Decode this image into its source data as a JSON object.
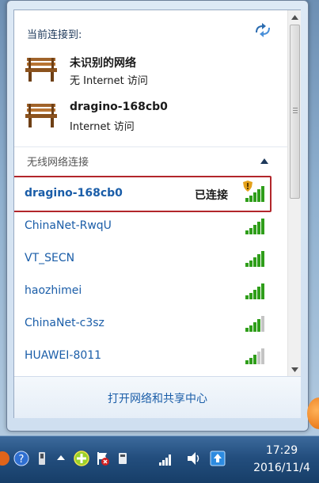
{
  "current_section": {
    "label": "当前连接到:"
  },
  "connections": [
    {
      "name": "未识别的网络",
      "status": "无 Internet 访问"
    },
    {
      "name": "dragino-168cb0",
      "status": "Internet 访问"
    }
  ],
  "wireless_section": {
    "label": "无线网络连接"
  },
  "networks": [
    {
      "name": "dragino-168cb0",
      "status": "已连接",
      "active": true
    },
    {
      "name": "ChinaNet-RwqU"
    },
    {
      "name": "VT_SECN"
    },
    {
      "name": "haozhimei"
    },
    {
      "name": "ChinaNet-c3sz"
    },
    {
      "name": "HUAWEI-8011"
    }
  ],
  "footer": {
    "link": "打开网络和共享中心"
  },
  "clock": {
    "time": "17:29",
    "date": "2016/11/4"
  },
  "colors": {
    "link": "#1a5da8",
    "signal": "#2f9e1a",
    "highlight": "#b2262b",
    "taskbar": "#234e7e"
  },
  "icons": [
    "bench-network-icon",
    "refresh-icon",
    "collapse-arrow-icon",
    "signal-strength-icon",
    "security-shield-icon",
    "scroll-up-icon",
    "scroll-down-icon"
  ]
}
